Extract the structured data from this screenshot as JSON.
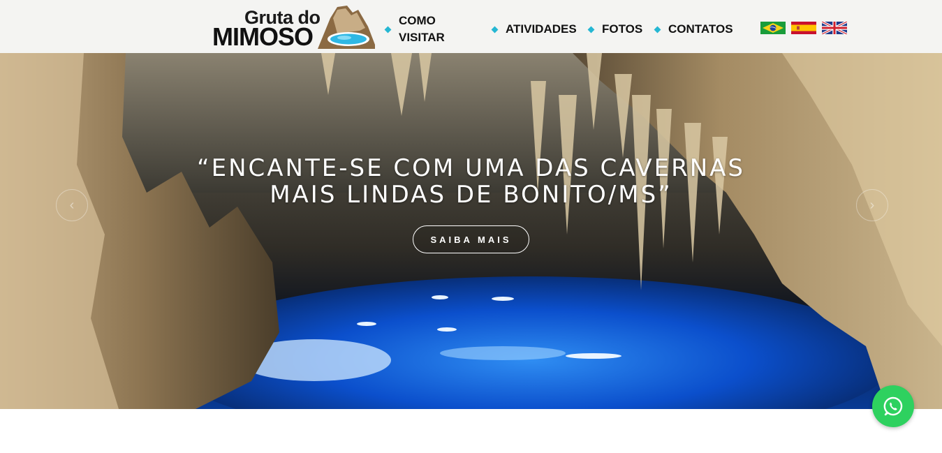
{
  "logo": {
    "line1": "Gruta do",
    "line2": "MIMOSO"
  },
  "nav": {
    "items": [
      {
        "label": "COMO VISITAR"
      },
      {
        "label": "ATIVIDADES"
      },
      {
        "label": "FOTOS"
      },
      {
        "label": "CONTATOS"
      }
    ]
  },
  "languages": [
    {
      "icon": "brazil-flag-icon",
      "language": "Português"
    },
    {
      "icon": "spain-flag-icon",
      "language": "Español"
    },
    {
      "icon": "uk-flag-icon",
      "language": "English"
    }
  ],
  "hero": {
    "quote_line1": "“ENCANTE-SE COM UMA DAS CAVERNAS",
    "quote_line2": "MAIS LINDAS DE BONITO/MS”",
    "button_label": "SAIBA MAIS",
    "prev_icon": "chevron-left-icon",
    "next_icon": "chevron-right-icon"
  },
  "whatsapp": {
    "icon": "whatsapp-icon"
  },
  "colors": {
    "accent": "#25b7d3",
    "whatsapp": "#2ed15f",
    "header_bg": "#f4f4f2",
    "water": "#0a4fc7"
  }
}
